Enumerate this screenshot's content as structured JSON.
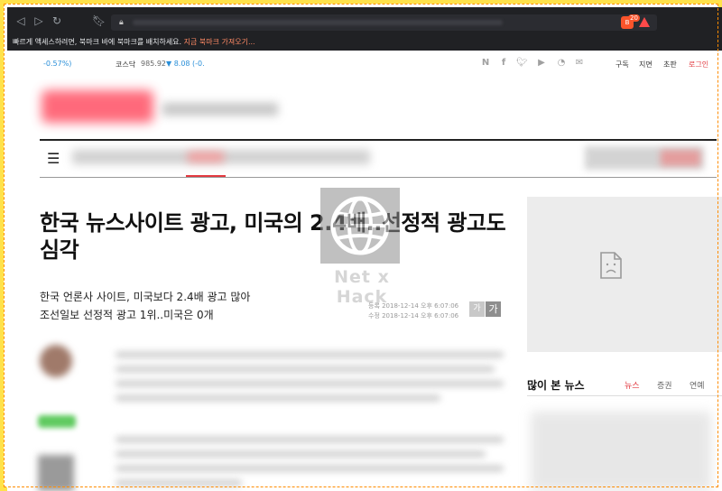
{
  "browser": {
    "brave_count": "20",
    "bookmark_prompt": "빠르게 액세스하려면, 북마크 바에 북마크를 배치하세요.",
    "bookmark_import": "지금 북마크 가져오기..."
  },
  "ticker": {
    "prev_change": "-0.57%)",
    "kosdaq_label": "코스닥",
    "kosdaq_value": "985.92",
    "kosdaq_change": "▼ 8.08 (-0.",
    "down_color": "#2a8fd8"
  },
  "sns_icons": [
    "naver-icon",
    "facebook-icon",
    "twitter-icon",
    "youtube-icon",
    "rss-icon",
    "mail-icon"
  ],
  "top_links": {
    "subscribe": "구독",
    "print_edition": "지면",
    "short": "초판",
    "login": "로그인",
    "login_color": "#e2383f"
  },
  "article": {
    "headline": "한국 뉴스사이트 광고, 미국의 2.4배..선정적 광고도 심각",
    "subtitle_1": "한국 언론사 사이트, 미국보다 2.4배 광고 많아",
    "subtitle_2": "조선일보 선정적 광고 1위..미국은 0개",
    "registered": "등록 2018-12-14 오후 6:07:06",
    "modified": "수정 2018-12-14 오후 6:07:06",
    "font_small": "가",
    "font_large": "가"
  },
  "popular": {
    "title": "많이 본 뉴스",
    "tabs": [
      {
        "label": "뉴스",
        "active": true
      },
      {
        "label": "증권",
        "active": false
      },
      {
        "label": "연예",
        "active": false
      }
    ],
    "active_color": "#e2383f"
  },
  "watermark": {
    "text": "Net x Hack"
  }
}
